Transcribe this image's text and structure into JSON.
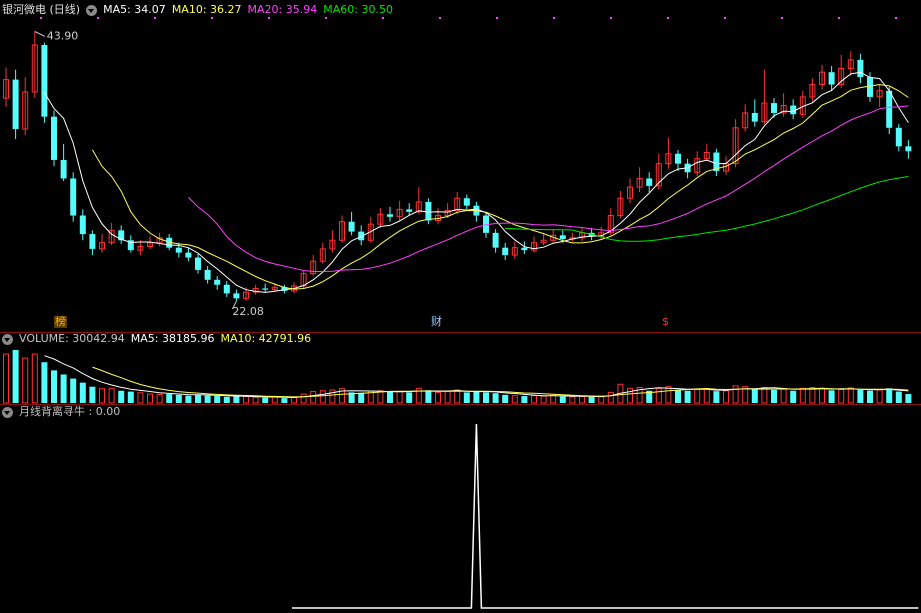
{
  "header": {
    "stock": "银河微电 (日线)",
    "ma_labels": [
      {
        "text": "MA5: 34.07",
        "color": "#ffffff"
      },
      {
        "text": "MA10: 36.27",
        "color": "#ffff54"
      },
      {
        "text": "MA20: 35.94",
        "color": "#ff40ff"
      },
      {
        "text": "MA60: 30.50",
        "color": "#00e600"
      }
    ]
  },
  "volume_header": {
    "labels": [
      {
        "text": "VOLUME: 30042.94",
        "color": "#c8c8c8"
      },
      {
        "text": "MA5: 38185.96",
        "color": "#ffffff"
      },
      {
        "text": "MA10: 42791.96",
        "color": "#ffff54"
      }
    ]
  },
  "indicator_header": {
    "label": "月线背离寻牛 : 0.00"
  },
  "annotations": {
    "high_label": "43.90",
    "low_label": "22.08"
  },
  "markers": [
    {
      "text": "榜",
      "color": "#ffb000",
      "background": "#5a3a00"
    },
    {
      "text": "财",
      "color": "#9fc8ff",
      "background": "#000000"
    },
    {
      "text": "$",
      "color": "#ff3030",
      "background": "#000000"
    }
  ],
  "colors": {
    "up": "#ff3232",
    "down": "#54fcfc",
    "ma5": "#ffffff",
    "ma10": "#ffff54",
    "ma20": "#ff40ff",
    "ma60": "#00e600",
    "separator": "#8a1010"
  },
  "chart_data": {
    "type": "candlestick",
    "price_high": 43.9,
    "price_low": 22.08,
    "candles": [
      [
        38.5,
        40.0,
        41.0,
        37.8
      ],
      [
        40.0,
        36.0,
        40.8,
        35.2
      ],
      [
        36.0,
        39.0,
        40.2,
        35.5
      ],
      [
        39.0,
        42.8,
        43.9,
        38.5
      ],
      [
        42.8,
        37.0,
        43.0,
        36.5
      ],
      [
        37.0,
        33.5,
        37.5,
        33.0
      ],
      [
        33.5,
        32.0,
        34.8,
        31.8
      ],
      [
        32.0,
        29.0,
        32.5,
        28.5
      ],
      [
        29.0,
        27.5,
        29.5,
        27.0
      ],
      [
        27.5,
        26.3,
        27.8,
        25.8
      ],
      [
        26.3,
        26.8,
        27.5,
        26.0
      ],
      [
        26.8,
        27.8,
        28.4,
        26.6
      ],
      [
        27.8,
        27.0,
        28.2,
        26.7
      ],
      [
        27.0,
        26.2,
        27.4,
        26.0
      ],
      [
        26.2,
        26.5,
        27.0,
        25.8
      ],
      [
        26.5,
        26.8,
        27.3,
        26.3
      ],
      [
        26.8,
        27.2,
        27.6,
        26.5
      ],
      [
        27.2,
        26.4,
        27.5,
        26.2
      ],
      [
        26.4,
        26.0,
        26.8,
        25.6
      ],
      [
        26.0,
        25.6,
        26.4,
        25.3
      ],
      [
        25.6,
        24.6,
        25.9,
        24.3
      ],
      [
        24.6,
        23.8,
        24.9,
        23.5
      ],
      [
        23.8,
        23.4,
        24.1,
        23.0
      ],
      [
        23.4,
        22.7,
        23.7,
        22.4
      ],
      [
        22.7,
        22.3,
        23.0,
        22.08
      ],
      [
        22.3,
        22.8,
        23.2,
        22.1
      ],
      [
        22.8,
        23.1,
        23.4,
        22.6
      ],
      [
        23.1,
        23.0,
        23.5,
        22.8
      ],
      [
        23.0,
        23.2,
        23.5,
        22.9
      ],
      [
        23.2,
        22.9,
        23.4,
        22.7
      ],
      [
        22.9,
        23.3,
        23.6,
        22.7
      ],
      [
        23.3,
        24.3,
        24.6,
        23.1
      ],
      [
        24.3,
        25.3,
        25.8,
        24.1
      ],
      [
        25.3,
        26.3,
        26.8,
        25.1
      ],
      [
        26.3,
        27.0,
        27.8,
        26.0
      ],
      [
        27.0,
        28.5,
        29.0,
        26.8
      ],
      [
        28.5,
        27.7,
        29.3,
        27.4
      ],
      [
        27.7,
        27.0,
        28.2,
        26.6
      ],
      [
        27.0,
        28.3,
        28.9,
        26.8
      ],
      [
        28.3,
        29.1,
        29.6,
        28.0
      ],
      [
        29.1,
        28.9,
        29.7,
        28.5
      ],
      [
        28.9,
        29.5,
        30.2,
        28.6
      ],
      [
        29.5,
        29.3,
        30.0,
        29.0
      ],
      [
        29.3,
        30.1,
        31.3,
        29.1
      ],
      [
        30.1,
        28.6,
        30.4,
        28.3
      ],
      [
        28.6,
        29.0,
        29.6,
        28.3
      ],
      [
        29.0,
        29.4,
        30.0,
        28.8
      ],
      [
        29.4,
        30.4,
        30.9,
        29.1
      ],
      [
        30.4,
        29.8,
        30.7,
        29.5
      ],
      [
        29.8,
        29.0,
        30.1,
        28.5
      ],
      [
        29.0,
        27.6,
        29.3,
        27.2
      ],
      [
        27.6,
        26.4,
        27.9,
        26.0
      ],
      [
        26.4,
        25.8,
        26.8,
        25.4
      ],
      [
        25.8,
        26.4,
        26.9,
        25.5
      ],
      [
        26.4,
        26.2,
        26.9,
        25.9
      ],
      [
        26.2,
        26.8,
        27.3,
        26.0
      ],
      [
        26.8,
        27.0,
        27.5,
        26.6
      ],
      [
        27.0,
        27.4,
        27.9,
        26.8
      ],
      [
        27.4,
        27.1,
        27.8,
        26.8
      ],
      [
        27.1,
        27.2,
        27.6,
        26.9
      ],
      [
        27.2,
        27.6,
        28.0,
        26.9
      ],
      [
        27.6,
        27.3,
        28.0,
        27.0
      ],
      [
        27.3,
        27.6,
        28.1,
        27.1
      ],
      [
        27.6,
        29.0,
        29.6,
        27.4
      ],
      [
        29.0,
        30.4,
        31.0,
        28.8
      ],
      [
        30.4,
        31.3,
        32.0,
        30.0
      ],
      [
        31.3,
        32.0,
        32.9,
        30.9
      ],
      [
        32.0,
        31.4,
        32.5,
        30.9
      ],
      [
        31.4,
        33.2,
        34.0,
        31.1
      ],
      [
        33.2,
        34.0,
        35.3,
        32.8
      ],
      [
        34.0,
        33.2,
        34.3,
        32.6
      ],
      [
        33.2,
        32.5,
        33.6,
        32.0
      ],
      [
        32.5,
        33.6,
        34.2,
        32.2
      ],
      [
        33.6,
        34.1,
        34.8,
        33.4
      ],
      [
        34.1,
        32.6,
        34.4,
        32.2
      ],
      [
        32.6,
        33.2,
        33.8,
        32.3
      ],
      [
        33.2,
        36.1,
        36.8,
        32.9
      ],
      [
        36.1,
        37.3,
        38.0,
        35.8
      ],
      [
        37.3,
        36.6,
        38.4,
        36.2
      ],
      [
        36.6,
        38.1,
        40.8,
        36.4
      ],
      [
        38.1,
        37.3,
        38.5,
        36.9
      ],
      [
        37.3,
        37.9,
        38.9,
        37.0
      ],
      [
        37.9,
        37.2,
        38.4,
        36.8
      ],
      [
        37.2,
        38.6,
        39.1,
        36.9
      ],
      [
        38.6,
        39.6,
        40.1,
        38.2
      ],
      [
        39.6,
        40.6,
        41.2,
        39.2
      ],
      [
        40.6,
        39.6,
        41.1,
        39.1
      ],
      [
        39.6,
        40.9,
        42.0,
        39.3
      ],
      [
        40.9,
        41.6,
        42.3,
        40.3
      ],
      [
        41.6,
        40.2,
        42.1,
        39.7
      ],
      [
        40.2,
        38.6,
        40.6,
        38.2
      ],
      [
        38.6,
        39.1,
        39.6,
        37.8
      ],
      [
        39.1,
        36.1,
        39.4,
        35.6
      ],
      [
        36.1,
        34.6,
        36.4,
        34.2
      ],
      [
        34.6,
        34.2,
        35.1,
        33.6
      ]
    ],
    "volume": [
      [
        12,
        1
      ],
      [
        13,
        0
      ],
      [
        11,
        1
      ],
      [
        12,
        1
      ],
      [
        10,
        0
      ],
      [
        8,
        0
      ],
      [
        7,
        0
      ],
      [
        6,
        0
      ],
      [
        5,
        0
      ],
      [
        4,
        0
      ],
      [
        3.5,
        1
      ],
      [
        3.6,
        1
      ],
      [
        3,
        0
      ],
      [
        2.8,
        0
      ],
      [
        2.5,
        1
      ],
      [
        2.2,
        1
      ],
      [
        2.1,
        1
      ],
      [
        2.2,
        0
      ],
      [
        2.0,
        0
      ],
      [
        1.8,
        0
      ],
      [
        2.0,
        0
      ],
      [
        1.8,
        0
      ],
      [
        1.7,
        0
      ],
      [
        1.5,
        0
      ],
      [
        1.6,
        0
      ],
      [
        1.6,
        1
      ],
      [
        1.4,
        1
      ],
      [
        1.3,
        0
      ],
      [
        1.5,
        1
      ],
      [
        1.2,
        0
      ],
      [
        1.4,
        1
      ],
      [
        2.2,
        1
      ],
      [
        2.8,
        1
      ],
      [
        3.0,
        1
      ],
      [
        3.2,
        1
      ],
      [
        3.5,
        1
      ],
      [
        2.6,
        0
      ],
      [
        2.5,
        0
      ],
      [
        2.9,
        1
      ],
      [
        3.0,
        1
      ],
      [
        2.7,
        0
      ],
      [
        2.8,
        1
      ],
      [
        2.6,
        0
      ],
      [
        3.6,
        1
      ],
      [
        3.1,
        0
      ],
      [
        2.6,
        1
      ],
      [
        2.8,
        1
      ],
      [
        3.2,
        1
      ],
      [
        2.6,
        0
      ],
      [
        2.8,
        0
      ],
      [
        2.6,
        0
      ],
      [
        2.4,
        0
      ],
      [
        2.0,
        0
      ],
      [
        1.8,
        1
      ],
      [
        1.7,
        0
      ],
      [
        1.8,
        1
      ],
      [
        1.7,
        1
      ],
      [
        1.9,
        1
      ],
      [
        1.6,
        0
      ],
      [
        1.5,
        1
      ],
      [
        1.6,
        1
      ],
      [
        1.5,
        0
      ],
      [
        1.7,
        1
      ],
      [
        2.6,
        1
      ],
      [
        4.6,
        1
      ],
      [
        3.6,
        1
      ],
      [
        3.8,
        1
      ],
      [
        3.0,
        0
      ],
      [
        3.6,
        1
      ],
      [
        4.0,
        1
      ],
      [
        3.2,
        0
      ],
      [
        3.0,
        0
      ],
      [
        3.3,
        1
      ],
      [
        3.4,
        1
      ],
      [
        2.9,
        0
      ],
      [
        3.0,
        1
      ],
      [
        4.2,
        1
      ],
      [
        4.0,
        1
      ],
      [
        3.4,
        0
      ],
      [
        3.8,
        1
      ],
      [
        3.2,
        0
      ],
      [
        3.4,
        1
      ],
      [
        3.0,
        0
      ],
      [
        3.6,
        1
      ],
      [
        3.8,
        1
      ],
      [
        3.6,
        1
      ],
      [
        3.1,
        0
      ],
      [
        3.3,
        1
      ],
      [
        3.7,
        1
      ],
      [
        3.2,
        0
      ],
      [
        3.0,
        0
      ],
      [
        3.2,
        1
      ],
      [
        3.6,
        0
      ],
      [
        2.8,
        0
      ],
      [
        2.2,
        0
      ]
    ],
    "indicator": {
      "spike_index": 49,
      "spike_value": 1,
      "start_index": 30
    }
  }
}
